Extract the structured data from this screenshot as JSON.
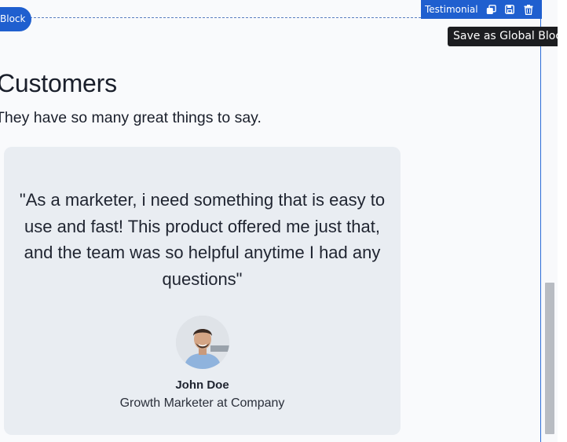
{
  "block": {
    "label": "Block"
  },
  "toolbar": {
    "label": "Testimonial",
    "icons": [
      "duplicate-icon",
      "save-icon",
      "trash-icon"
    ]
  },
  "tooltip": {
    "text": "Save as Global Block"
  },
  "section": {
    "heading": "Customers",
    "subheading": "They have so many great things to say."
  },
  "testimonial": {
    "quote": "\"As a marketer, i need something that is easy to use and fast! This product offered me just that, and the team was so helpful anytime I had any questions\"",
    "name": "John Doe",
    "role": "Growth Marketer at Company"
  },
  "colors": {
    "accent": "#1f5fcf",
    "card_bg": "#e9edf2",
    "tooltip_bg": "#1c1d20"
  }
}
